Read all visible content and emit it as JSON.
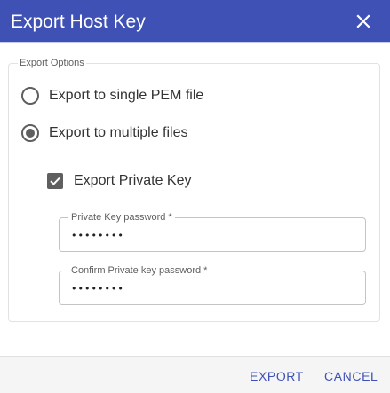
{
  "dialog": {
    "title": "Export Host Key",
    "close_icon": "close-icon",
    "accent_color": "#3f51b5"
  },
  "export_options": {
    "legend": "Export Options",
    "radio_single_label": "Export to single PEM file",
    "radio_multiple_label": "Export to multiple files",
    "selected": "multiple",
    "export_private_key_label": "Export Private Key",
    "export_private_key_checked": true,
    "private_key_password_label": "Private Key password *",
    "private_key_password_value": "abcdefgh",
    "confirm_password_label": "Confirm Private key password *",
    "confirm_password_value": "abcdefgh"
  },
  "footer": {
    "export_label": "EXPORT",
    "cancel_label": "CANCEL"
  }
}
